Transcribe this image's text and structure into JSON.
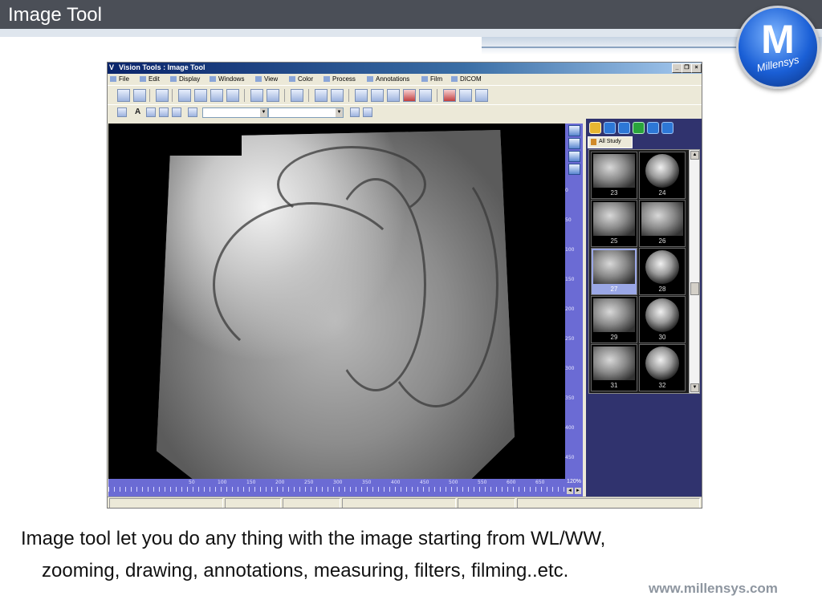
{
  "slide": {
    "title": "Image Tool",
    "caption_line1": "Image tool let you do any thing with the image starting from WL/WW,",
    "caption_line2": "zooming, drawing, annotations, measuring, filters, filming..etc.",
    "footer_url": "www.millensys.com",
    "logo_letter": "M",
    "logo_text": "Millensys"
  },
  "window": {
    "title": "Vision Tools : Image Tool",
    "title_icon": "V",
    "controls": [
      "_",
      "❐",
      "×"
    ]
  },
  "menu": {
    "items": [
      "File",
      "Edit",
      "Display",
      "Windows",
      "View",
      "Color",
      "Process",
      "Annotations",
      "Film",
      "DICOM"
    ]
  },
  "toolbar2": {
    "text_tool": "A"
  },
  "viewer": {
    "vertical_ruler_labels": [
      "0",
      "50",
      "100",
      "150",
      "200",
      "250",
      "300",
      "350",
      "400",
      "450"
    ],
    "horizontal_ruler_labels": [
      "50",
      "100",
      "150",
      "200",
      "250",
      "300",
      "350",
      "400",
      "450",
      "500",
      "550",
      "600",
      "650"
    ],
    "zoom_level": "120%"
  },
  "study_panel": {
    "tab_label": "All Study",
    "thumbnails": [
      {
        "number": "23",
        "selected": false,
        "round": false
      },
      {
        "number": "24",
        "selected": false,
        "round": true
      },
      {
        "number": "25",
        "selected": false,
        "round": false
      },
      {
        "number": "26",
        "selected": false,
        "round": false
      },
      {
        "number": "27",
        "selected": true,
        "round": false
      },
      {
        "number": "28",
        "selected": false,
        "round": true
      },
      {
        "number": "29",
        "selected": false,
        "round": false
      },
      {
        "number": "30",
        "selected": false,
        "round": true
      },
      {
        "number": "31",
        "selected": false,
        "round": false
      },
      {
        "number": "32",
        "selected": false,
        "round": true
      }
    ]
  },
  "colors": {
    "header_bg": "#4b4f57",
    "ruler_bg": "#6b6bd4",
    "panel_bg": "#30336e",
    "window_bg": "#ece9d8"
  }
}
